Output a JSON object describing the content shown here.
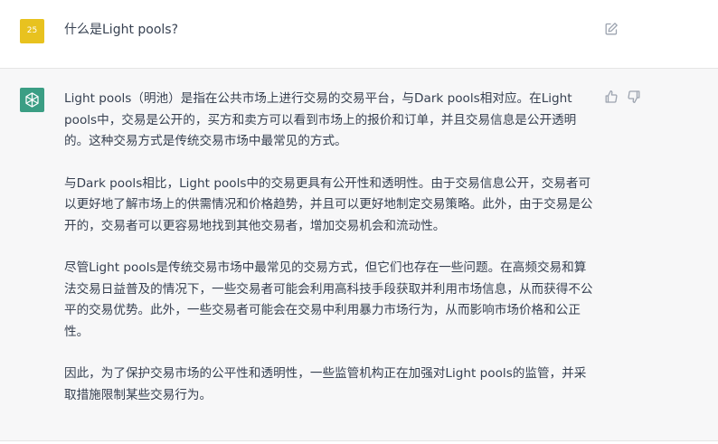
{
  "user": {
    "avatar_text": "25",
    "avatar_color": "#e8c21f",
    "message": "什么是Light pools?"
  },
  "assistant": {
    "avatar_color": "#3b9e84",
    "paragraphs": [
      "Light pools（明池）是指在公共市场上进行交易的交易平台，与Dark pools相对应。在Light pools中，交易是公开的，买方和卖方可以看到市场上的报价和订单，并且交易信息是公开透明的。这种交易方式是传统交易市场中最常见的方式。",
      "与Dark pools相比，Light pools中的交易更具有公开性和透明性。由于交易信息公开，交易者可以更好地了解市场上的供需情况和价格趋势，并且可以更好地制定交易策略。此外，由于交易是公开的，交易者可以更容易地找到其他交易者，增加交易机会和流动性。",
      "尽管Light pools是传统交易市场中最常见的交易方式，但它们也存在一些问题。在高频交易和算法交易日益普及的情况下，一些交易者可能会利用高科技手段获取并利用市场信息，从而获得不公平的交易优势。此外，一些交易者可能会在交易中利用暴力市场行为，从而影响市场价格和公正性。",
      "因此，为了保护交易市场的公平性和透明性，一些监管机构正在加强对Light pools的监管，并采取措施限制某些交易行为。"
    ]
  },
  "icons": {
    "edit": "edit-icon",
    "thumbs_up": "thumbs-up-icon",
    "thumbs_down": "thumbs-down-icon",
    "assistant_logo": "openai-logo-icon"
  }
}
